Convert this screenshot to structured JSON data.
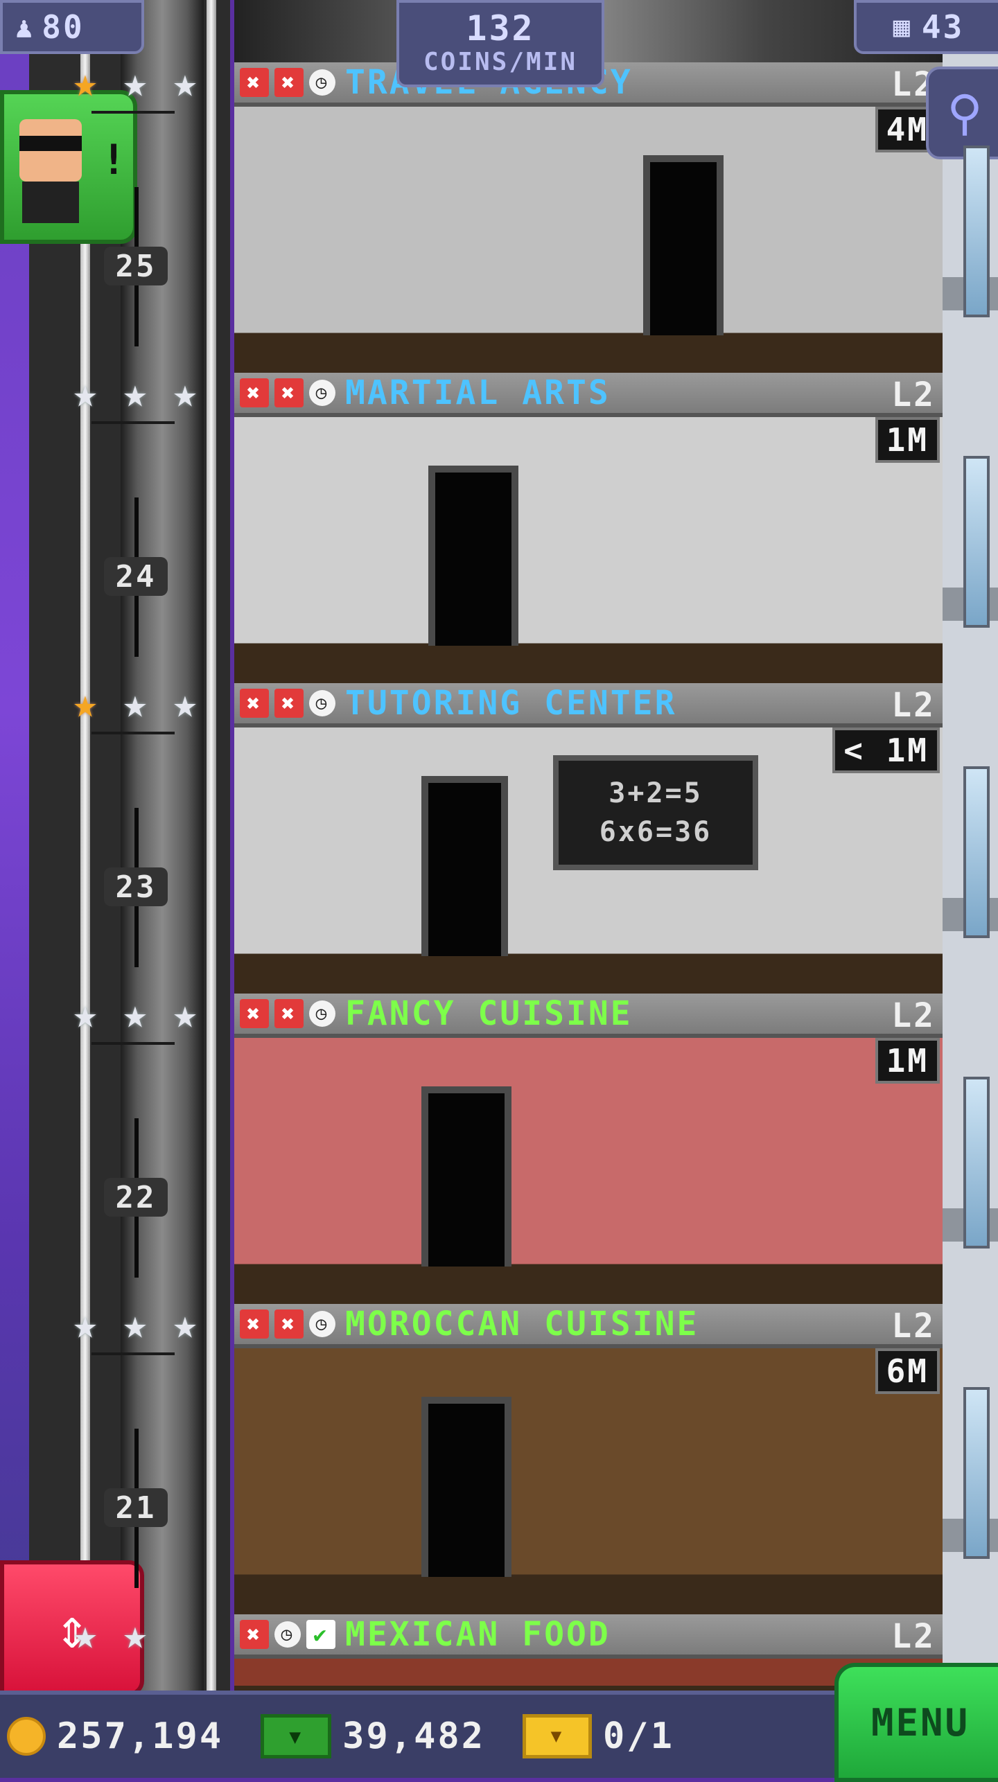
{
  "hud": {
    "population": "80",
    "coins_per_min_value": "132",
    "coins_per_min_unit": "COINS/MIN",
    "floor_count": "43"
  },
  "floors": [
    {
      "number": "25",
      "name": "TRAVEL AGENCY",
      "name_color": "blue",
      "level": "L2",
      "price": "4M",
      "stars": [
        "gold",
        "silver",
        "silver"
      ],
      "status": [
        "x",
        "x",
        "clock"
      ]
    },
    {
      "number": "24",
      "name": "MARTIAL ARTS",
      "name_color": "blue",
      "level": "L2",
      "price": "1M",
      "stars": [
        "silver",
        "silver",
        "silver"
      ],
      "status": [
        "x",
        "x",
        "clock"
      ]
    },
    {
      "number": "23",
      "name": "TUTORING CENTER",
      "name_color": "blue",
      "level": "L2",
      "price": "< 1M",
      "stars": [
        "gold",
        "silver",
        "silver"
      ],
      "status": [
        "x",
        "x",
        "clock"
      ]
    },
    {
      "number": "22",
      "name": "FANCY CUISINE",
      "name_color": "green",
      "level": "L2",
      "price": "1M",
      "stars": [
        "silver",
        "silver",
        "silver"
      ],
      "status": [
        "x",
        "x",
        "clock"
      ]
    },
    {
      "number": "21",
      "name": "MOROCCAN CUISINE",
      "name_color": "green",
      "level": "L2",
      "price": "6M",
      "stars": [
        "silver",
        "silver",
        "silver"
      ],
      "status": [
        "x",
        "x",
        "clock"
      ]
    },
    {
      "number": "",
      "name": "MEXICAN FOOD",
      "name_color": "green",
      "level": "L2",
      "price": "",
      "stars": [
        "silver",
        "silver"
      ],
      "status": [
        "x",
        "clock",
        "check"
      ]
    }
  ],
  "chalkboard": {
    "line1": "3+2=5",
    "line2": "6x6=36"
  },
  "bottom_bar": {
    "coins": "257,194",
    "bux": "39,482",
    "tickets": "0/1",
    "menu_label": "MENU"
  },
  "icons": {
    "population": "person-icon",
    "floors": "building-icon",
    "search": "magnifier-icon",
    "elevator": "up-down-arrows-icon"
  },
  "colors": {
    "hud_bg": "#4a4e7a",
    "menu_green": "#3ee05a",
    "elevator_red": "#ff4a6a",
    "name_blue": "#4ec3ff",
    "name_green": "#7dff4a"
  }
}
